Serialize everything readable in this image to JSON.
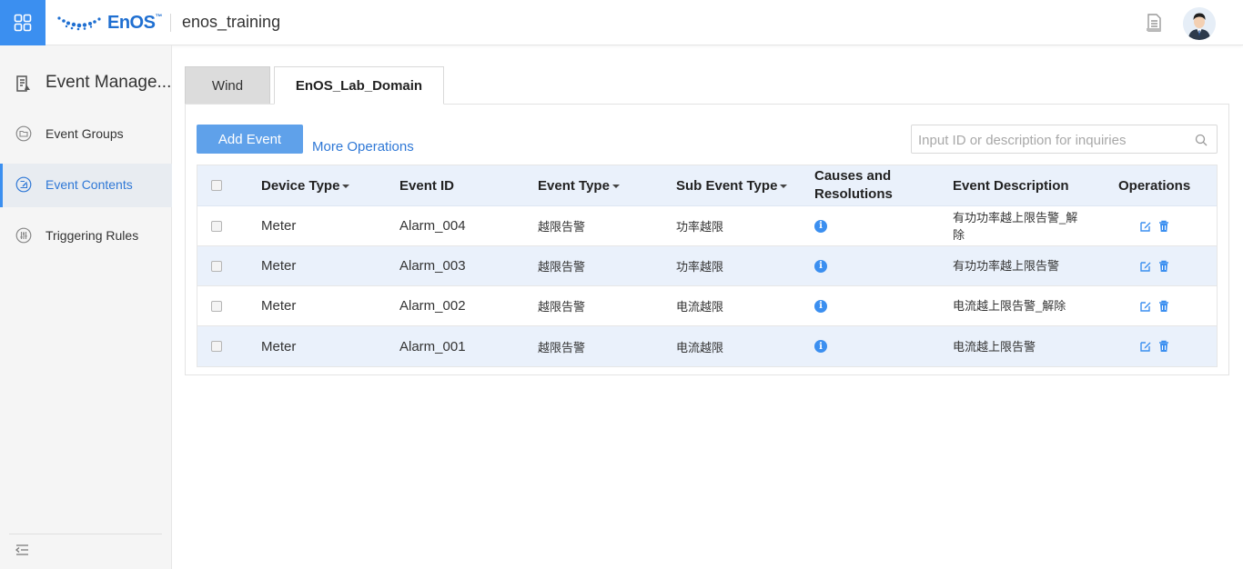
{
  "header": {
    "logo_text": "EnOS",
    "logo_tm": "™",
    "org_name": "enos_training"
  },
  "sidebar": {
    "title": "Event Manage...",
    "items": [
      {
        "label": "Event Groups",
        "active": false
      },
      {
        "label": "Event Contents",
        "active": true
      },
      {
        "label": "Triggering Rules",
        "active": false
      }
    ]
  },
  "tabs": [
    {
      "label": "Wind",
      "active": false
    },
    {
      "label": "EnOS_Lab_Domain",
      "active": true
    }
  ],
  "toolbar": {
    "add_label": "Add Event",
    "more_label": "More Operations",
    "search_placeholder": "Input ID or description for inquiries"
  },
  "table": {
    "headers": {
      "device_type": "Device Type",
      "event_id": "Event ID",
      "event_type": "Event Type",
      "sub_event_type": "Sub Event Type",
      "causes_line1": "Causes and",
      "causes_line2": "Resolutions",
      "description": "Event Description",
      "operations": "Operations"
    },
    "rows": [
      {
        "device_type": "Meter",
        "event_id": "Alarm_004",
        "event_type": "越限告警",
        "sub_event_type": "功率越限",
        "description": "有功功率越上限告警_解除"
      },
      {
        "device_type": "Meter",
        "event_id": "Alarm_003",
        "event_type": "越限告警",
        "sub_event_type": "功率越限",
        "description": "有功功率越上限告警"
      },
      {
        "device_type": "Meter",
        "event_id": "Alarm_002",
        "event_type": "越限告警",
        "sub_event_type": "电流越限",
        "description": "电流越上限告警_解除"
      },
      {
        "device_type": "Meter",
        "event_id": "Alarm_001",
        "event_type": "越限告警",
        "sub_event_type": "电流越限",
        "description": "电流越上限告警"
      }
    ]
  },
  "colors": {
    "accent": "#3b8ff0",
    "header_row_bg": "#eaf1fb",
    "link": "#2f78d6"
  },
  "icons": {
    "app_switcher": "grid-icon",
    "document": "document-icon",
    "info": "info-icon",
    "edit": "edit-icon",
    "delete": "trash-icon",
    "search": "search-icon",
    "collapse": "collapse-menu-icon"
  }
}
